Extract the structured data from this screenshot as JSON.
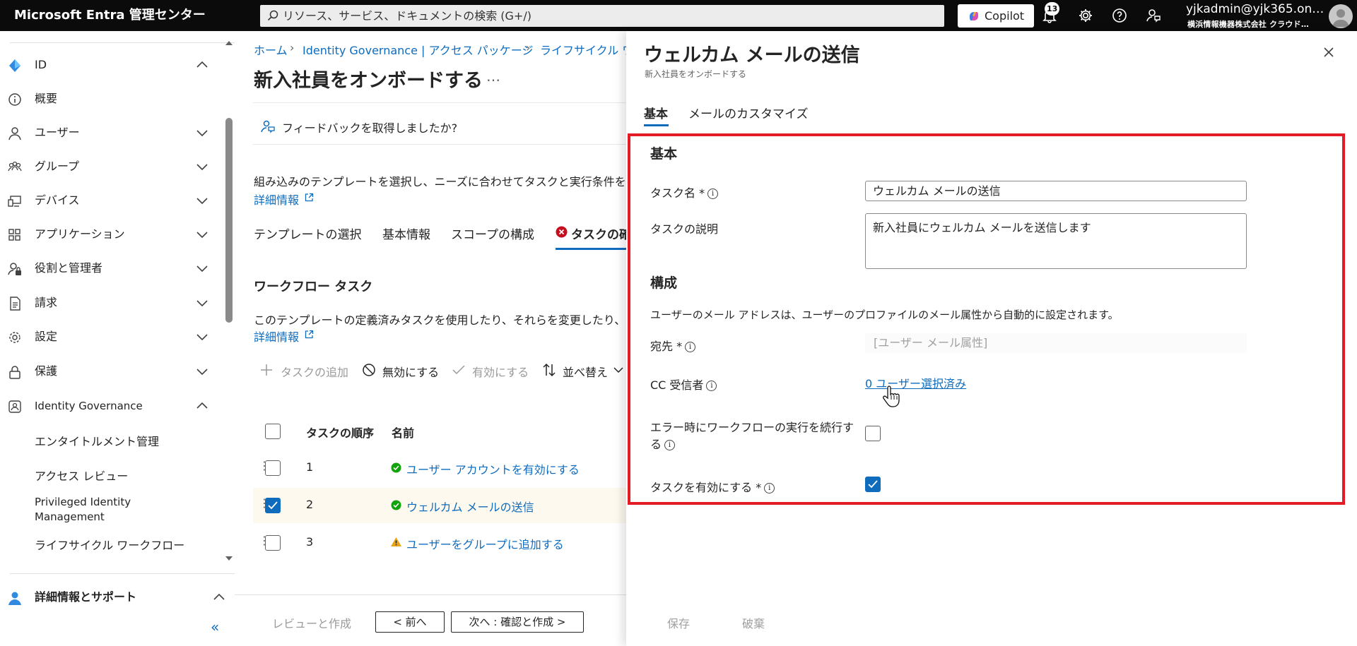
{
  "app": {
    "brand": "Microsoft Entra 管理センター",
    "search_placeholder": "リソース、サービス、ドキュメントの検索 (G+/)",
    "copilot_label": "Copilot",
    "notification_count": "13",
    "account_email": "yjkadmin@yjk365.on…",
    "account_org": "横浜情報機器株式会社 クラウド…"
  },
  "nav": {
    "items": [
      {
        "label": "ID",
        "icon": "diamond-icon"
      },
      {
        "label": "概要",
        "icon": "info-icon"
      },
      {
        "label": "ユーザー",
        "icon": "user-icon"
      },
      {
        "label": "グループ",
        "icon": "group-icon"
      },
      {
        "label": "デバイス",
        "icon": "device-icon"
      },
      {
        "label": "アプリケーション",
        "icon": "apps-icon"
      },
      {
        "label": "役割と管理者",
        "icon": "role-icon"
      },
      {
        "label": "請求",
        "icon": "billing-icon"
      },
      {
        "label": "設定",
        "icon": "gear-icon"
      },
      {
        "label": "保護",
        "icon": "lock-icon"
      },
      {
        "label": "Identity Governance",
        "icon": "governance-icon"
      }
    ],
    "sub_items": [
      "エンタイトルメント管理",
      "アクセス レビュー",
      "Privileged Identity",
      "Management",
      "ライフサイクル ワークフロー"
    ],
    "footer": {
      "label": "詳細情報とサポート",
      "collapse": "«"
    }
  },
  "main": {
    "breadcrumb": [
      "ホーム",
      "Identity Governance | アクセス パッケージ",
      "ライフサイクル ワー"
    ],
    "title": "新入社員をオンボードする",
    "more": "…",
    "feedback": "フィードバックを取得しましたか?",
    "description": "組み込みのテンプレートを選択し、ニーズに合わせてタスクと実行条件を変",
    "learn_more": "詳細情報",
    "wizard_tabs": [
      "テンプレートの選択",
      "基本情報",
      "スコープの構成",
      "タスクの確"
    ],
    "section_title": "ワークフロー タスク",
    "section_desc": "このテンプレートの定義済みタスクを使用したり、それらを変更したり、",
    "section_learn_more": "詳細情報",
    "commands": {
      "add": "タスクの追加",
      "disable": "無効にする",
      "enable": "有効にする",
      "sort": "並べ替え"
    },
    "table": {
      "headers": [
        "タスクの順序",
        "名前"
      ],
      "rows": [
        {
          "order": "1",
          "name": "ユーザー アカウントを有効にする",
          "status": "success",
          "checked": false
        },
        {
          "order": "2",
          "name": "ウェルカム メールの送信",
          "status": "success",
          "checked": true
        },
        {
          "order": "3",
          "name": "ユーザーをグループに追加する",
          "status": "warning",
          "checked": false
        }
      ]
    },
    "buttons": {
      "review": "レビューと作成",
      "prev": "< 前へ",
      "next": "次へ : 確認と作成 >"
    }
  },
  "panel": {
    "title": "ウェルカム メールの送信",
    "subtitle": "新入社員をオンボードする",
    "tabs": [
      "基本",
      "メールのカスタマイズ"
    ],
    "basic_heading": "基本",
    "task_name_label": "タスク名 *",
    "task_name_value": "ウェルカム メールの送信",
    "task_desc_label": "タスクの説明",
    "task_desc_value": "新入社員にウェルカム メールを送信します",
    "config_heading": "構成",
    "config_note": "ユーザーのメール アドレスは、ユーザーのプロファイルのメール属性から自動的に設定されます。",
    "to_label": "宛先 *",
    "to_value": "[ユーザー メール属性]",
    "cc_label": "CC 受信者",
    "cc_link": "0 ユーザー選択済み",
    "continue_label_1": "エラー時にワークフローの実行を続行す",
    "continue_label_2": "る",
    "continue_checked": false,
    "enable_label": "タスクを有効にする *",
    "enable_checked": true,
    "save": "保存",
    "discard": "破棄",
    "info_glyph": "i",
    "colors": {
      "accent": "#0f6cbd",
      "highlight_border": "#e21b24",
      "success": "#13a10e",
      "warning": "#e8a317"
    }
  }
}
